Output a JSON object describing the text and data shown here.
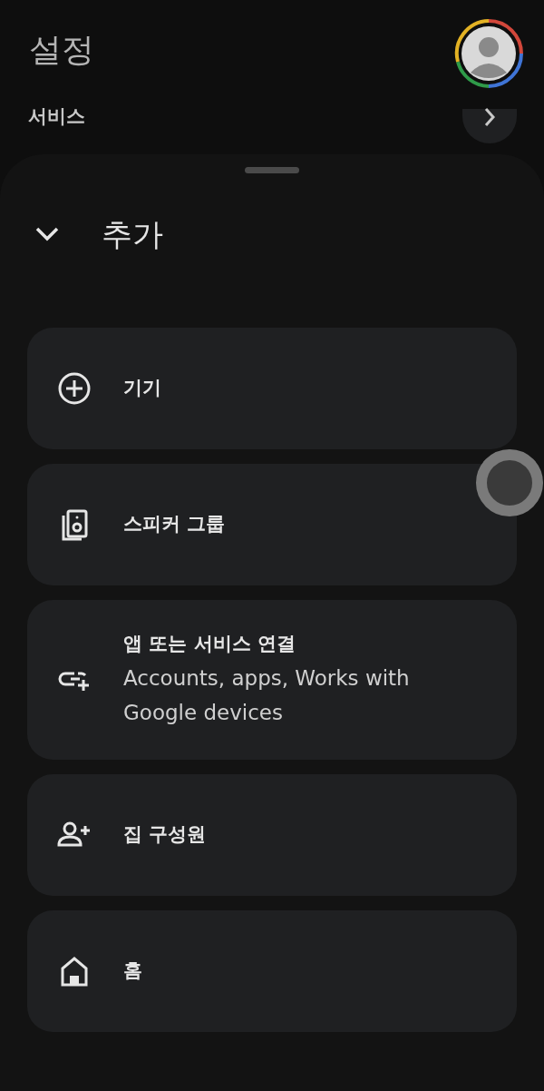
{
  "header": {
    "title": "설정",
    "section": "서비스"
  },
  "sheet": {
    "title": "추가",
    "expanded": true,
    "items": [
      {
        "kind": "device",
        "label": "기기"
      },
      {
        "kind": "speakers",
        "label": "스피커 그룹"
      },
      {
        "kind": "link",
        "label": "앱 또는 서비스 연결",
        "subtitle": "Accounts, apps, Works with Google devices"
      },
      {
        "kind": "member",
        "label": "집 구성원"
      },
      {
        "kind": "home",
        "label": "홈"
      }
    ]
  }
}
